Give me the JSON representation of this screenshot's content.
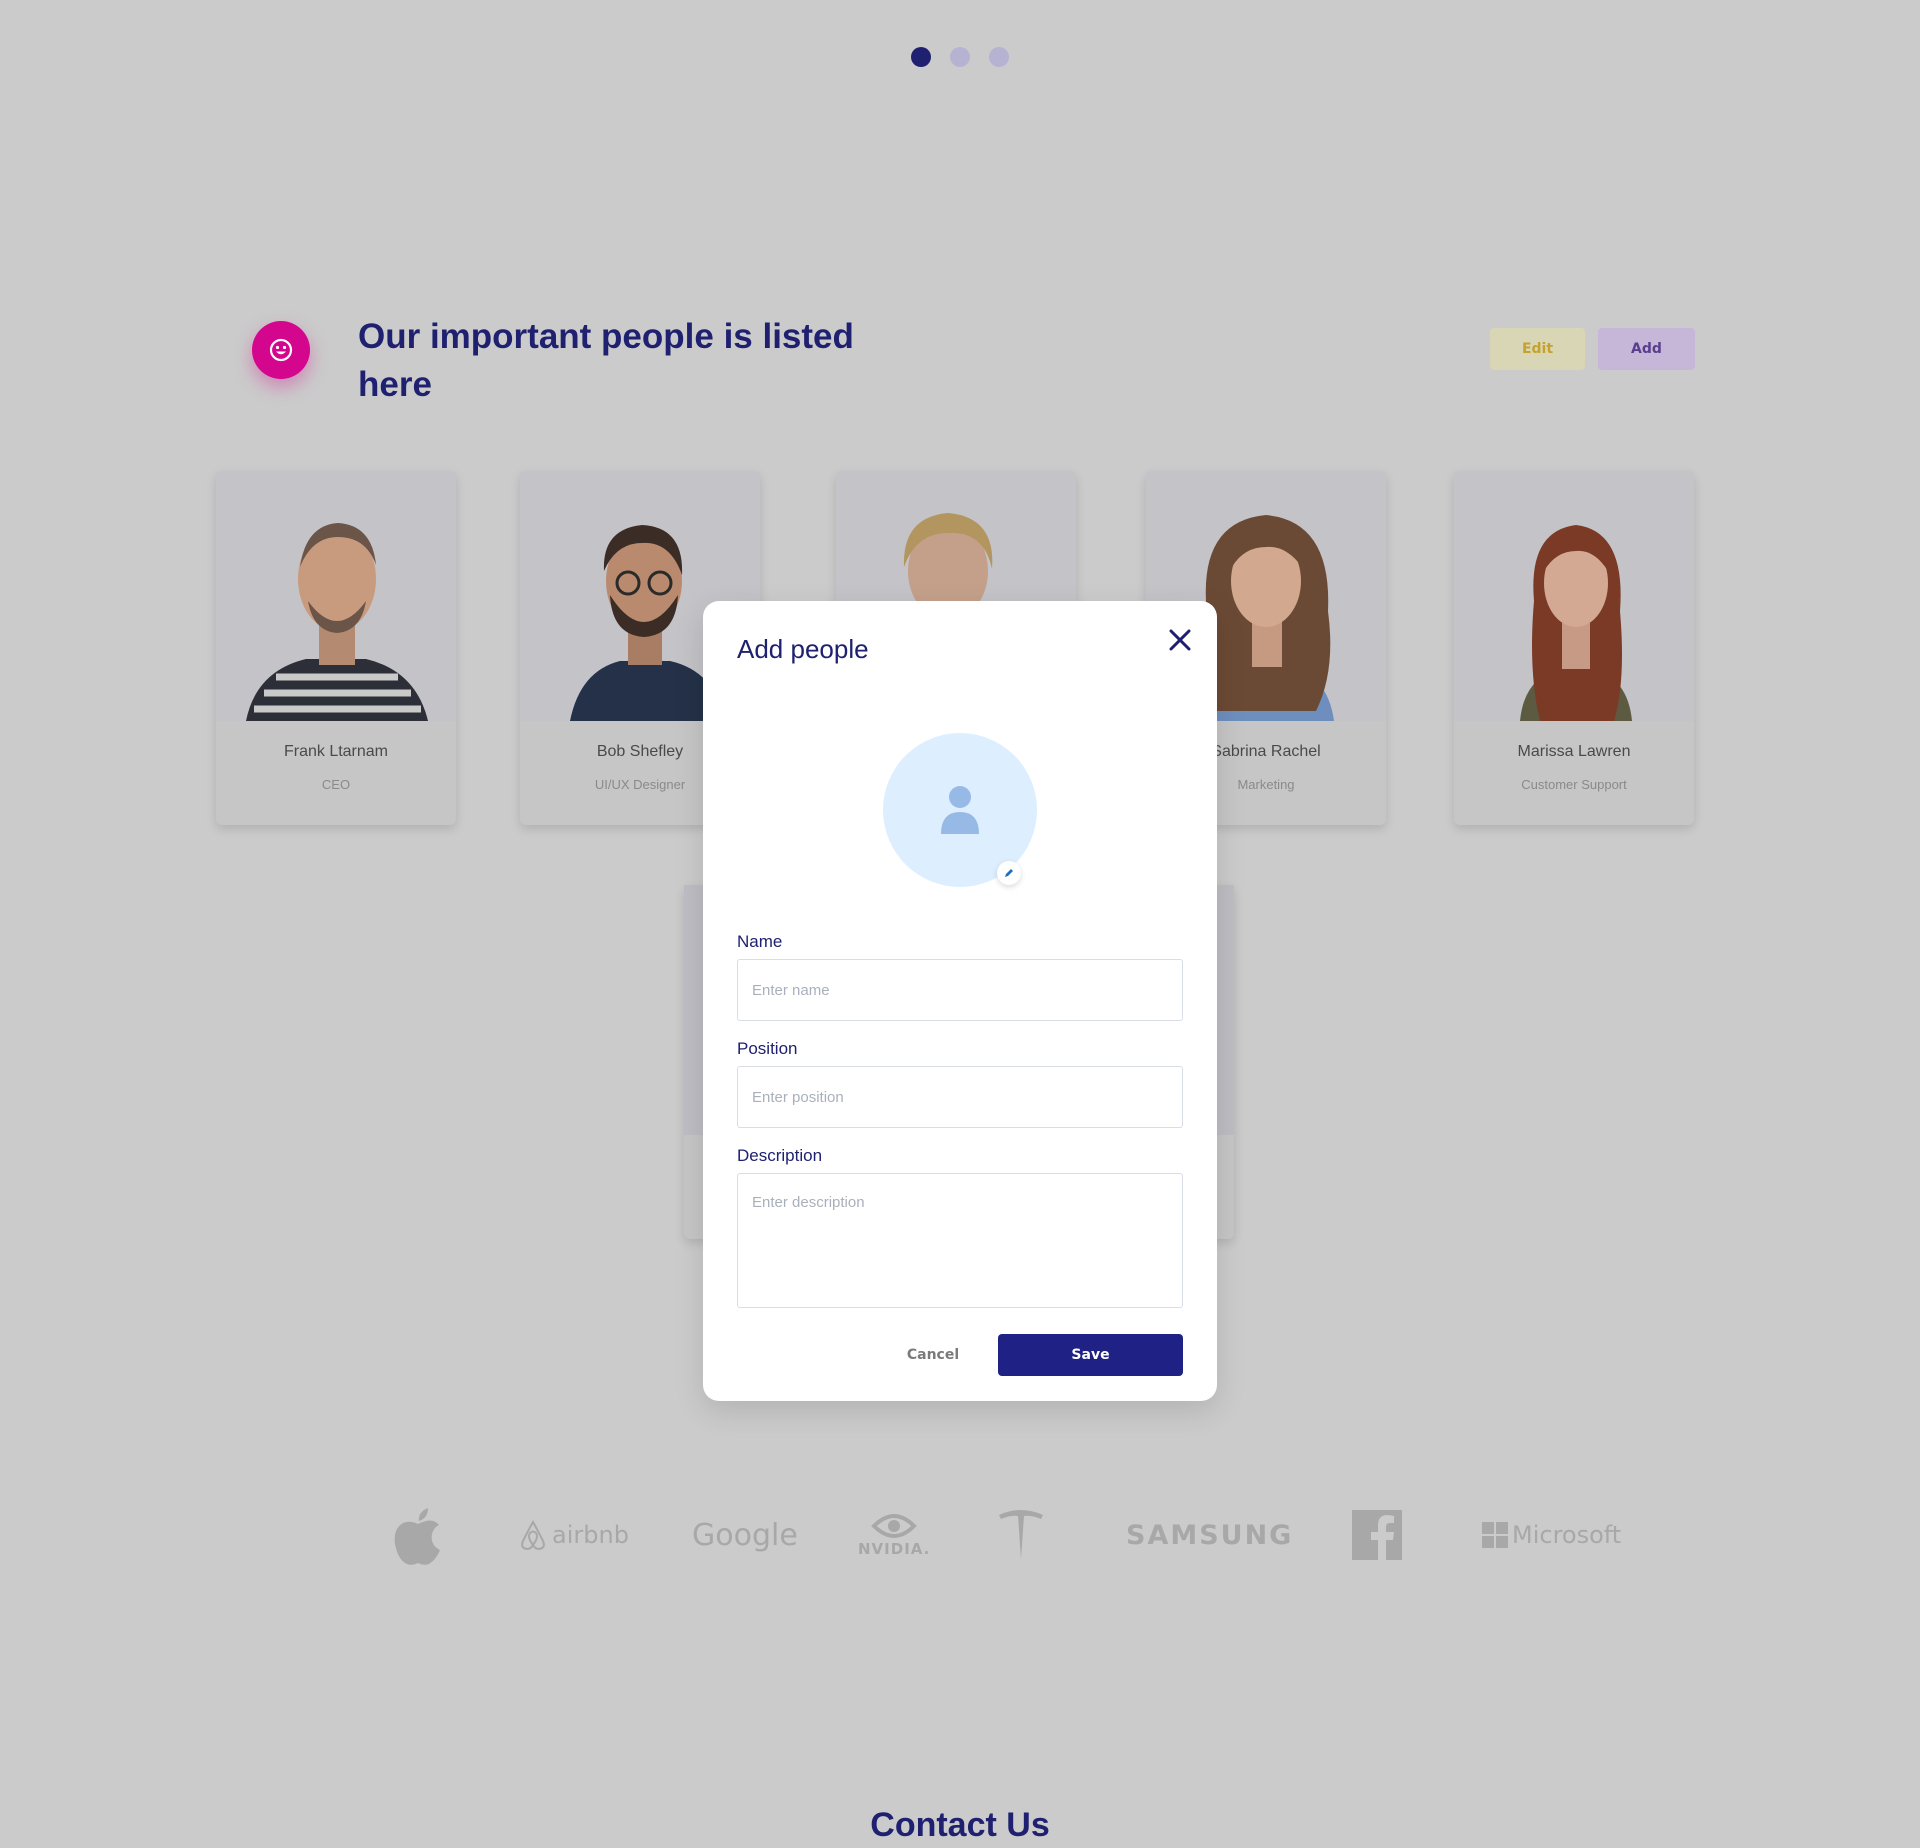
{
  "carousel": {
    "dots": [
      {
        "active": true
      },
      {
        "active": false
      },
      {
        "active": false
      }
    ]
  },
  "people_section": {
    "title": "Our important people is listed here",
    "edit_label": "Edit",
    "add_label": "Add",
    "badge_icon": "smile-icon",
    "accent_color": "#d4068d",
    "people": [
      {
        "name": "Frank Ltarnam",
        "role": "CEO"
      },
      {
        "name": "Bob Shefley",
        "role": "UI/UX Designer"
      },
      {
        "name": "",
        "role": ""
      },
      {
        "name": "Sabrina Rachel",
        "role": "Marketing"
      },
      {
        "name": "Marissa Lawren",
        "role": "Customer Support"
      }
    ]
  },
  "logos": [
    {
      "icon": "apple-logo"
    },
    {
      "text": "airbnb"
    },
    {
      "text": "Google"
    },
    {
      "text": "NVIDIA."
    },
    {
      "icon": "tesla-logo"
    },
    {
      "text": "SAMSUNG"
    },
    {
      "icon": "facebook-logo"
    },
    {
      "text": "Microsoft"
    }
  ],
  "contact": {
    "title": "Contact Us"
  },
  "modal": {
    "title": "Add people",
    "close_icon": "close-icon",
    "avatar_icon": "user-icon",
    "avatar_edit_icon": "pencil-icon",
    "name_label": "Name",
    "name_placeholder": "Enter name",
    "name_value": "",
    "position_label": "Position",
    "position_placeholder": "Enter position",
    "position_value": "",
    "description_label": "Description",
    "description_placeholder": "Enter description",
    "description_value": "",
    "cancel_label": "Cancel",
    "save_label": "Save",
    "primary_color": "#1f2185"
  }
}
